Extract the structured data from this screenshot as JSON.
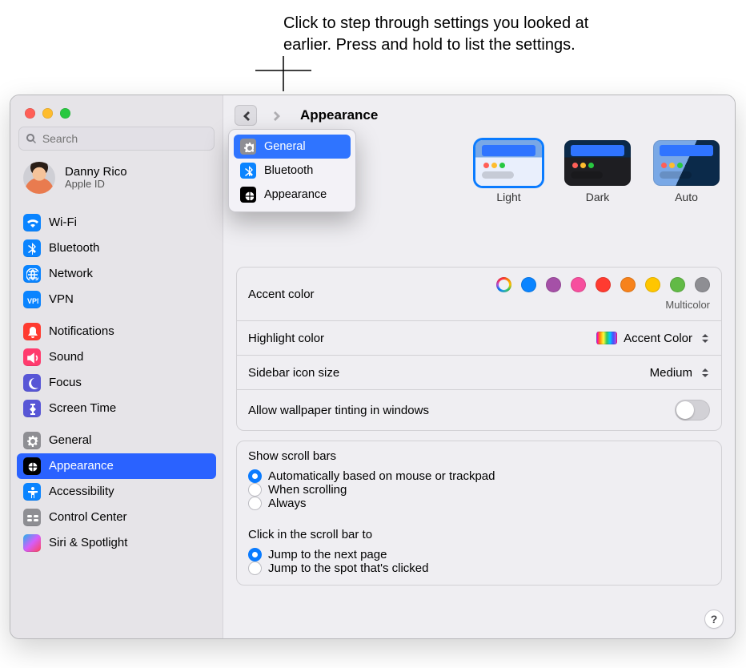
{
  "callout": "Click to step through settings you looked at earlier.  Press and hold to list the settings.",
  "search_placeholder": "Search",
  "profile": {
    "name": "Danny Rico",
    "subtitle": "Apple ID"
  },
  "sidebar": {
    "groups": [
      [
        {
          "icon": "wifi",
          "label": "Wi-Fi"
        },
        {
          "icon": "bt",
          "label": "Bluetooth"
        },
        {
          "icon": "net",
          "label": "Network"
        },
        {
          "icon": "vpn",
          "label": "VPN"
        }
      ],
      [
        {
          "icon": "notif",
          "label": "Notifications"
        },
        {
          "icon": "sound",
          "label": "Sound"
        },
        {
          "icon": "focus",
          "label": "Focus"
        },
        {
          "icon": "st",
          "label": "Screen Time"
        }
      ],
      [
        {
          "icon": "gen",
          "label": "General"
        },
        {
          "icon": "app",
          "label": "Appearance",
          "selected": true
        },
        {
          "icon": "acc",
          "label": "Accessibility"
        },
        {
          "icon": "cc",
          "label": "Control Center"
        },
        {
          "icon": "siri",
          "label": "Siri & Spotlight"
        }
      ]
    ]
  },
  "content": {
    "title": "Appearance",
    "history_menu": [
      {
        "icon": "gen",
        "label": "General",
        "selected": true
      },
      {
        "icon": "bt",
        "label": "Bluetooth"
      },
      {
        "icon": "app",
        "label": "Appearance"
      }
    ],
    "themes": {
      "items": [
        {
          "label": "Light",
          "selected": true
        },
        {
          "label": "Dark"
        },
        {
          "label": "Auto"
        }
      ]
    },
    "accent": {
      "label": "Accent color",
      "selected_label": "Multicolor",
      "swatches": [
        "multi",
        "#0a84ff",
        "#a550a7",
        "#f74f9e",
        "#ff3b30",
        "#f7821b",
        "#ffc600",
        "#62ba46",
        "#8e8e93"
      ]
    },
    "highlight": {
      "label": "Highlight color",
      "value": "Accent Color"
    },
    "sidebar_icon": {
      "label": "Sidebar icon size",
      "value": "Medium"
    },
    "tinting": {
      "label": "Allow wallpaper tinting in windows",
      "on": false
    },
    "scroll": {
      "title": "Show scroll bars",
      "options": [
        "Automatically based on mouse or trackpad",
        "When scrolling",
        "Always"
      ],
      "selected": 0
    },
    "scroll_click": {
      "title": "Click in the scroll bar to",
      "options": [
        "Jump to the next page",
        "Jump to the spot that's clicked"
      ],
      "selected": 0
    },
    "help": "?"
  }
}
